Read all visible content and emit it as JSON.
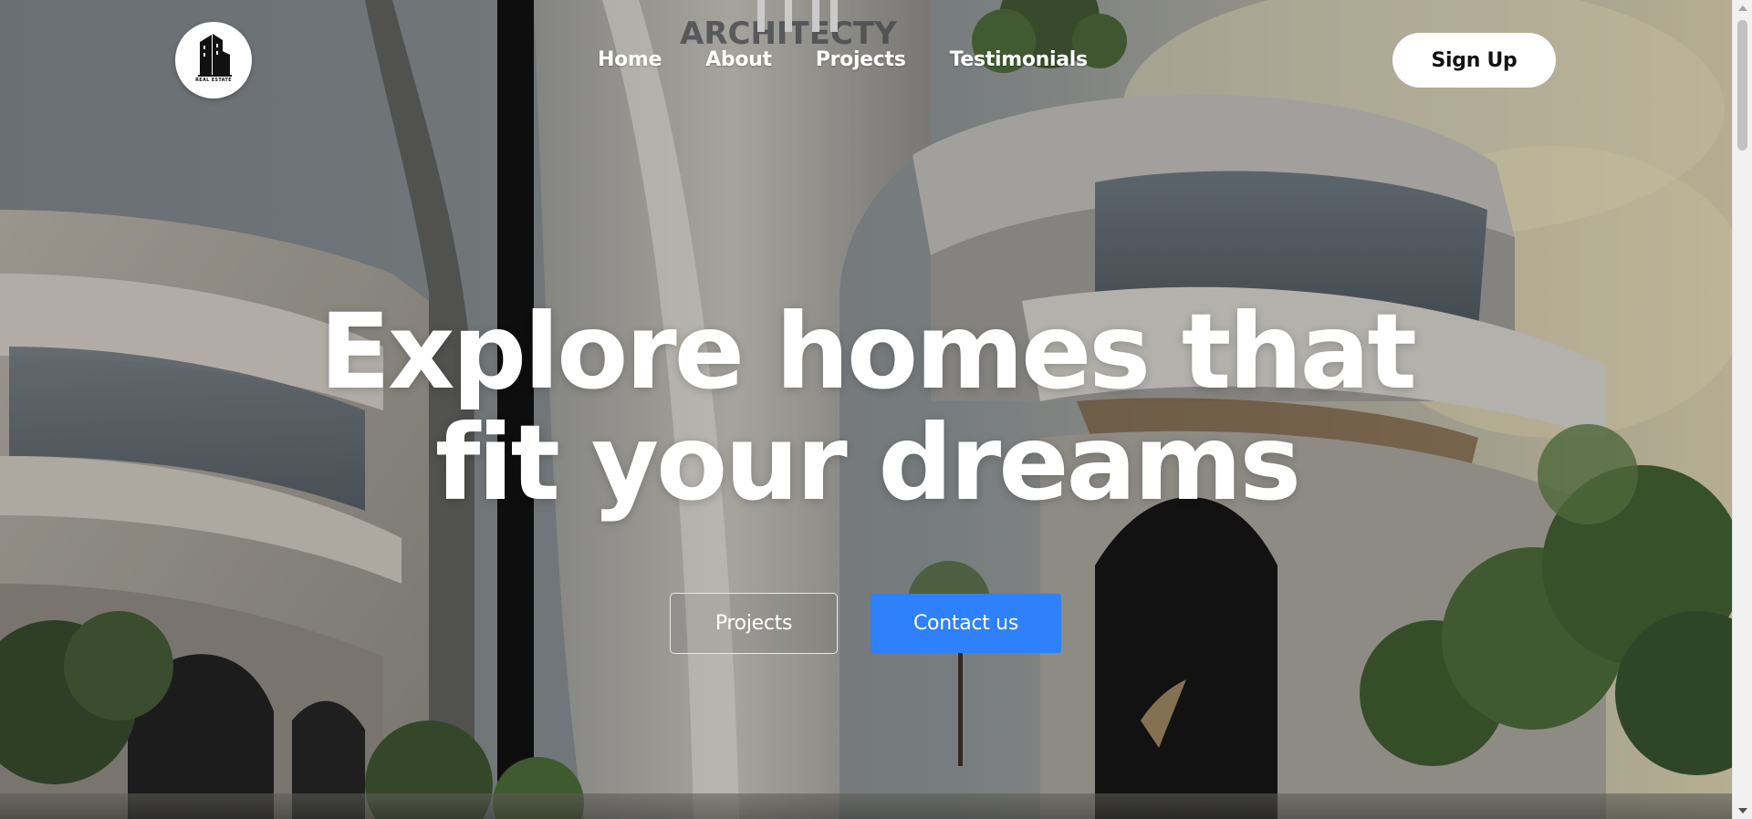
{
  "site": {
    "logo_text": "REAL ESTATE"
  },
  "navbar": {
    "links": [
      {
        "label": "Home"
      },
      {
        "label": "About"
      },
      {
        "label": "Projects"
      },
      {
        "label": "Testimonials"
      }
    ],
    "signup_label": "Sign Up"
  },
  "hero": {
    "headline_line1": "Explore homes that",
    "headline_line2": "fit your dreams",
    "projects_button": "Projects",
    "contact_button": "Contact us",
    "sign_text": "ARCHITECTY"
  },
  "colors": {
    "accent_blue": "#2f80fb",
    "headline_text": "#ffffff",
    "signup_bg": "#ffffff"
  },
  "icons": {
    "logo": "building-logo-icon",
    "scroll_up": "scroll-up-arrow-icon",
    "scroll_down": "scroll-down-arrow-icon"
  }
}
